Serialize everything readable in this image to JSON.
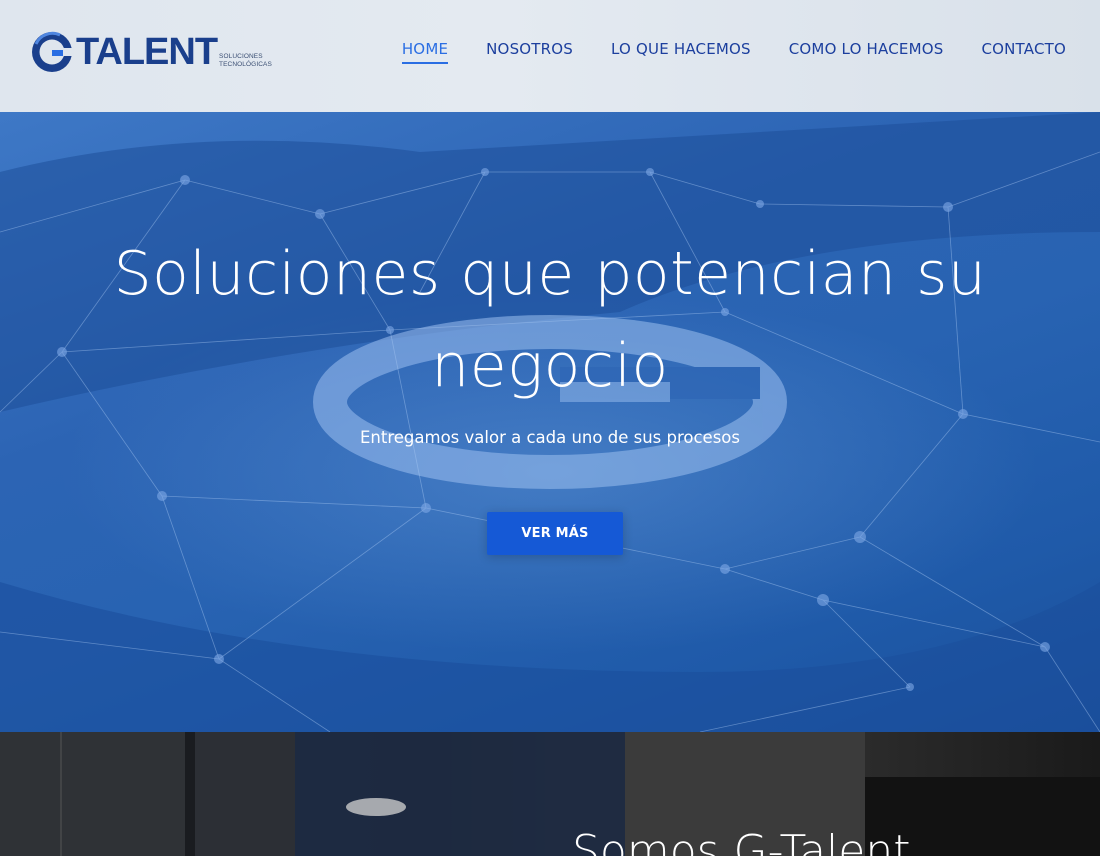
{
  "header": {
    "logo": {
      "wordmark": "TALENT",
      "tagline_line1": "SOLUCIONES",
      "tagline_line2": "TECNOLÓGICAS"
    },
    "nav": [
      {
        "label": "HOME",
        "active": true
      },
      {
        "label": "NOSOTROS",
        "active": false
      },
      {
        "label": "LO QUE HACEMOS",
        "active": false
      },
      {
        "label": "COMO LO HACEMOS",
        "active": false
      },
      {
        "label": "CONTACTO",
        "active": false
      }
    ]
  },
  "hero": {
    "title": "Soluciones que potencian su negocio",
    "subtitle": "Entregamos valor a cada uno de sus procesos",
    "button_label": "VER MÁS"
  },
  "about": {
    "title": "Somos G-Talent"
  },
  "colors": {
    "brand_navy": "#1a3f8c",
    "nav_text": "#1c3f9e",
    "nav_active": "#2a6ee3",
    "hero_blue": "#2863b2",
    "button_blue": "#1559d6"
  }
}
